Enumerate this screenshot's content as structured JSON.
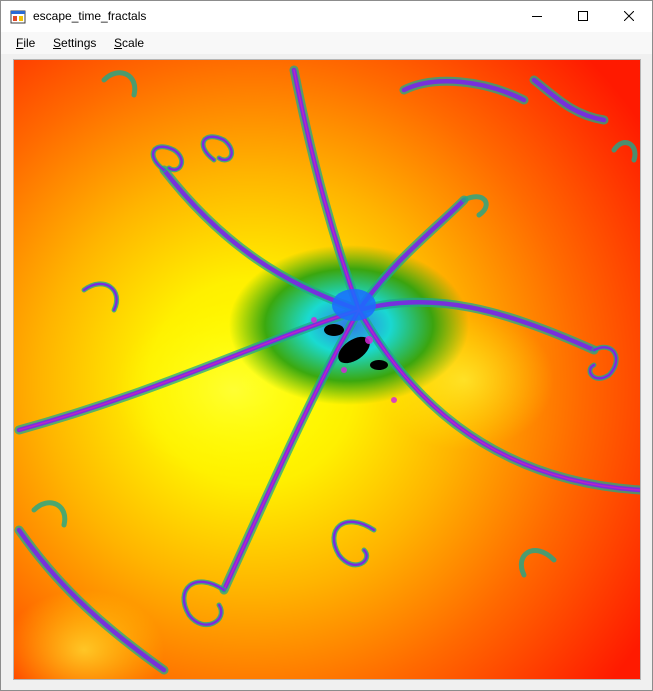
{
  "window": {
    "title": "escape_time_fractals"
  },
  "titlebar": {
    "icon": "app-window-icon",
    "minimize_icon": "minimize-icon",
    "maximize_icon": "maximize-icon",
    "close_icon": "close-icon"
  },
  "menubar": {
    "items": [
      {
        "label_rest": "ile",
        "mnemonic": "F"
      },
      {
        "label_rest": "ettings",
        "mnemonic": "S"
      },
      {
        "label_rest": "cale",
        "mnemonic": "S"
      }
    ]
  },
  "canvas": {
    "content": "julia-set-fractal-render",
    "palette": {
      "outer": "#ff1a00",
      "mid": "#ffa500",
      "inner_glow": "#ffff00",
      "green": "#22a000",
      "cyan": "#00e5e5",
      "blue": "#1a6cff",
      "violet": "#8a2be2",
      "magenta": "#e020e0",
      "core": "#000000"
    }
  }
}
